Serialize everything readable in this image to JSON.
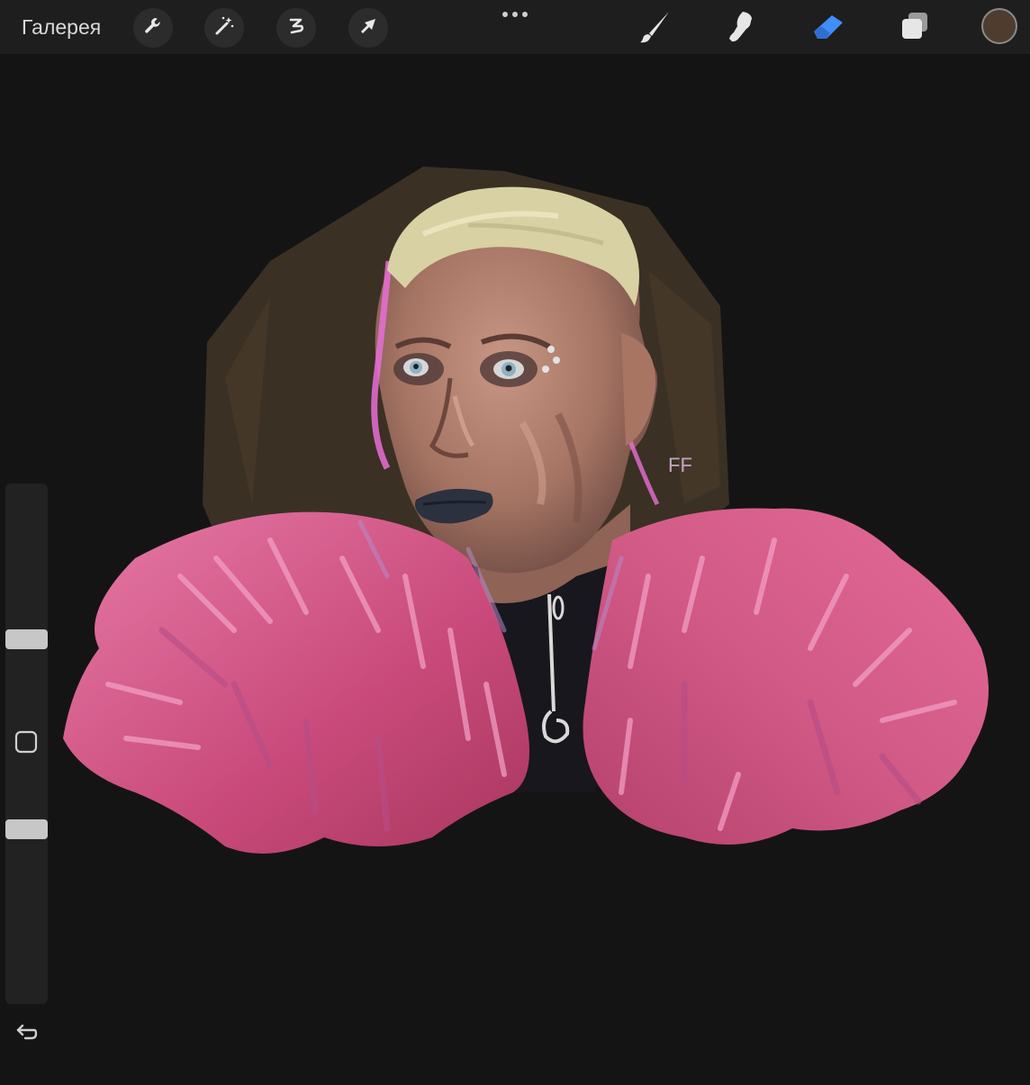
{
  "toolbar": {
    "gallery_label": "Галерея",
    "left_tools": [
      "wrench-icon",
      "magic-wand-icon",
      "selection-icon",
      "transform-arrow-icon"
    ],
    "more_icon": "more-dots-icon",
    "right_tools": [
      "brush-icon",
      "smudge-icon",
      "eraser-icon",
      "layers-icon"
    ],
    "active_tool": "eraser",
    "active_color": "#4e3d2e",
    "accent_color": "#3f8efc"
  },
  "sidebar": {
    "brush_size_level": 0.25,
    "opacity_level": 0.77,
    "modify_icon": "square-icon",
    "undo_icon": "undo-icon"
  },
  "canvas": {
    "background_color": "#151414",
    "artwork_signature": "FF",
    "palette": {
      "backdrop_brown": "#3c3126",
      "skin": "#b58675",
      "hair": "#d9d3a6",
      "fur_pink": "#d9588a",
      "fur_light": "#e98bb6",
      "lips": "#2c3140",
      "eyes": "#8fb2c2",
      "shirt": "#15151c"
    }
  }
}
